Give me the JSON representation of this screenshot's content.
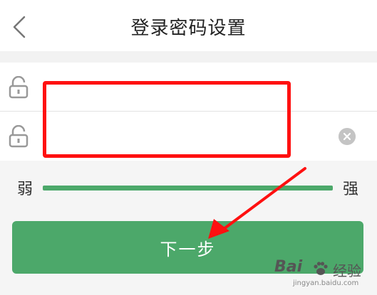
{
  "header": {
    "title": "登录密码设置"
  },
  "form": {
    "password_value": "",
    "confirm_value": ""
  },
  "strength": {
    "weak_label": "弱",
    "strong_label": "强",
    "level_fraction": 1.0
  },
  "actions": {
    "next_label": "下一步"
  },
  "watermark": {
    "logo": "Bai",
    "text": "经验",
    "url": "jingyan.baidu.com"
  },
  "colors": {
    "accent": "#4ca86a",
    "highlight": "#ff1010",
    "header_bg": "#ffffff",
    "page_bg": "#f5f5f5"
  }
}
